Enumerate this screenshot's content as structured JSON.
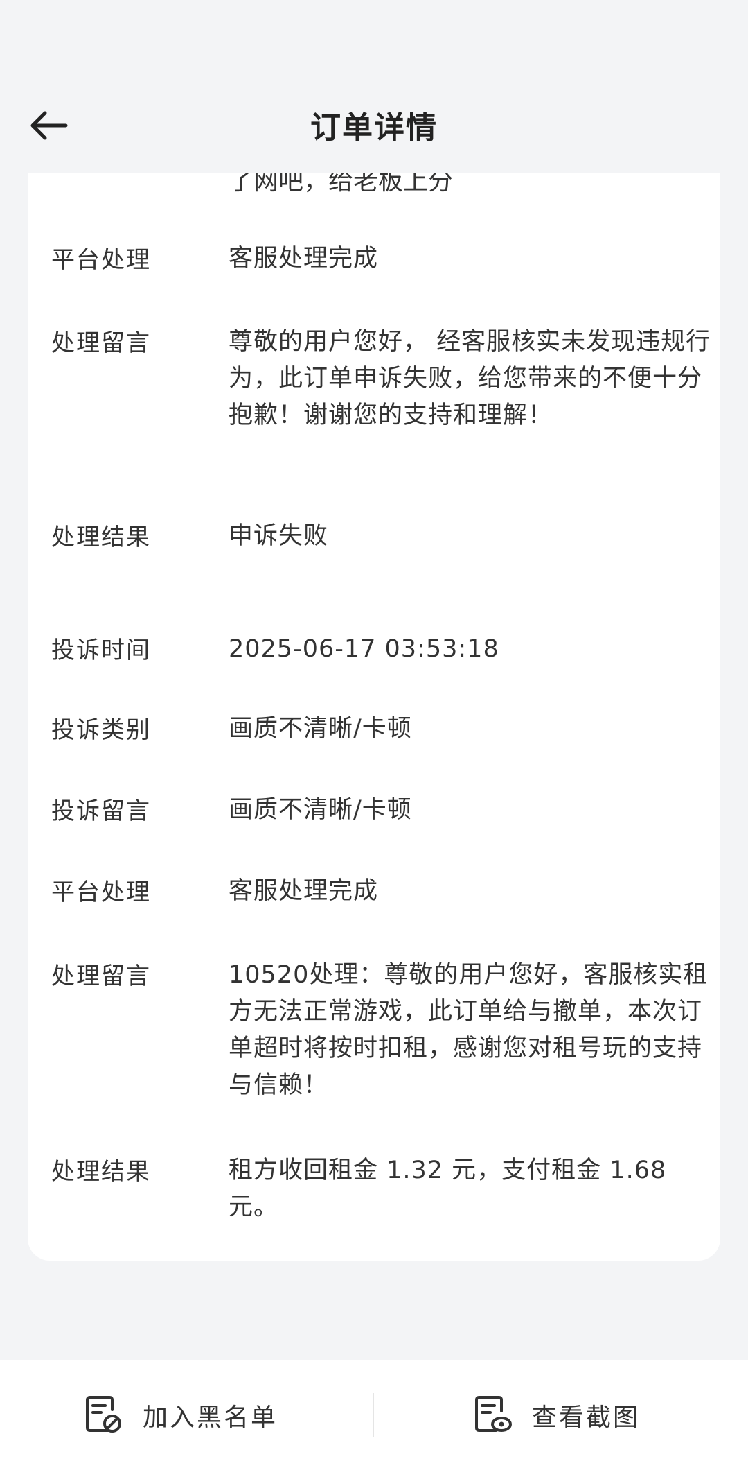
{
  "header": {
    "title": "订单详情",
    "back_icon": "arrow-left-icon"
  },
  "card": {
    "cut_text": "了网吧，给老板上分",
    "rows": [
      {
        "label": "平台处理",
        "value": "客服处理完成"
      },
      {
        "label": "处理留言",
        "value": "尊敬的用户您好， 经客服核实未发现违规行为，此订单申诉失败，给您带来的不便十分抱歉！谢谢您的支持和理解！"
      },
      {
        "label": "处理结果",
        "value": "申诉失败"
      },
      {
        "label": "投诉时间",
        "value": "2025-06-17 03:53:18"
      },
      {
        "label": "投诉类别",
        "value": "画质不清晰/卡顿"
      },
      {
        "label": "投诉留言",
        "value": "画质不清晰/卡顿"
      },
      {
        "label": "平台处理",
        "value": "客服处理完成"
      },
      {
        "label": "处理留言",
        "value": "10520处理：尊敬的用户您好，客服核实租方无法正常游戏，此订单给与撤单，本次订单超时将按时扣租，感谢您对租号玩的支持与信赖！"
      },
      {
        "label": "处理结果",
        "value": "租方收回租金 1.32 元，支付租金 1.68 元。"
      }
    ]
  },
  "bottom_bar": {
    "blacklist_label": "加入黑名单",
    "blacklist_icon": "document-block-icon",
    "screenshot_label": "查看截图",
    "screenshot_icon": "document-view-icon"
  }
}
